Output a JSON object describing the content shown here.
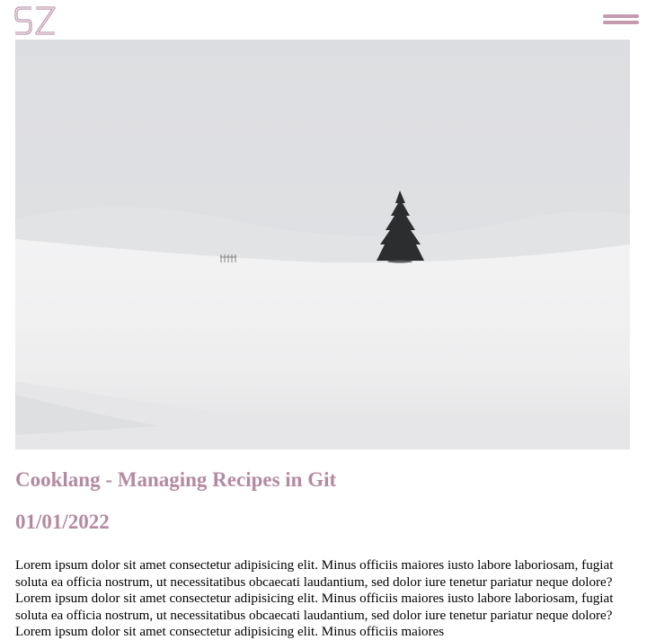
{
  "header": {
    "logo_text": "SZ",
    "logo_icon": "sz-monogram-logo",
    "menu_icon": "hamburger-menu-icon",
    "accent_color": "#c39ab0"
  },
  "hero": {
    "image_icon": "snowy-landscape-lone-tree-image"
  },
  "post": {
    "title": "Cooklang - Managing Recipes in Git",
    "date": "01/01/2022",
    "body": "Lorem ipsum dolor sit amet consectetur adipisicing elit. Minus officiis maiores iusto labore laboriosam, fugiat soluta ea officia nostrum, ut necessitatibus obcaecati laudantium, sed dolor iure tenetur pariatur neque dolore? Lorem ipsum dolor sit amet consectetur adipisicing elit. Minus officiis maiores iusto labore laboriosam, fugiat soluta ea officia nostrum, ut necessitatibus obcaecati laudantium, sed dolor iure tenetur pariatur neque dolore? Lorem ipsum dolor sit amet consectetur adipisicing elit. Minus officiis maiores",
    "heading_color": "#b48aa1"
  }
}
